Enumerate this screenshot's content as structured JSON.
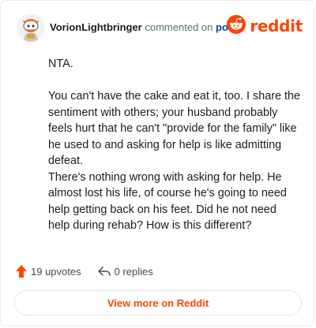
{
  "header": {
    "username": "VorionLightbringer",
    "action_text": "commented on",
    "post_link": "post",
    "brand": "reddit",
    "avatar_icon": "snoo-avatar-icon",
    "logo_icon": "reddit-logo-icon"
  },
  "comment": {
    "paragraphs": [
      "NTA.",
      "You can't have the cake and eat it, too. I share the sentiment with others; your husband probably feels hurt that he can't \"provide for the family\" like he used to and asking for help is like admitting defeat.",
      "There's nothing wrong with asking for help. He almost lost his life, of course he's going to need help getting back on his feet. Did he not need help during rehab? How is this different?"
    ]
  },
  "footer": {
    "upvotes": "19 upvotes",
    "replies": "0 replies",
    "view_more": "View more on Reddit",
    "upvote_icon": "upvote-arrow-icon",
    "reply_icon": "reply-arrow-icon"
  },
  "colors": {
    "brand": "#ff4500",
    "link": "#0045ac",
    "text": "#1c1c1c",
    "muted": "#576f76",
    "border": "#e6e8ea"
  }
}
